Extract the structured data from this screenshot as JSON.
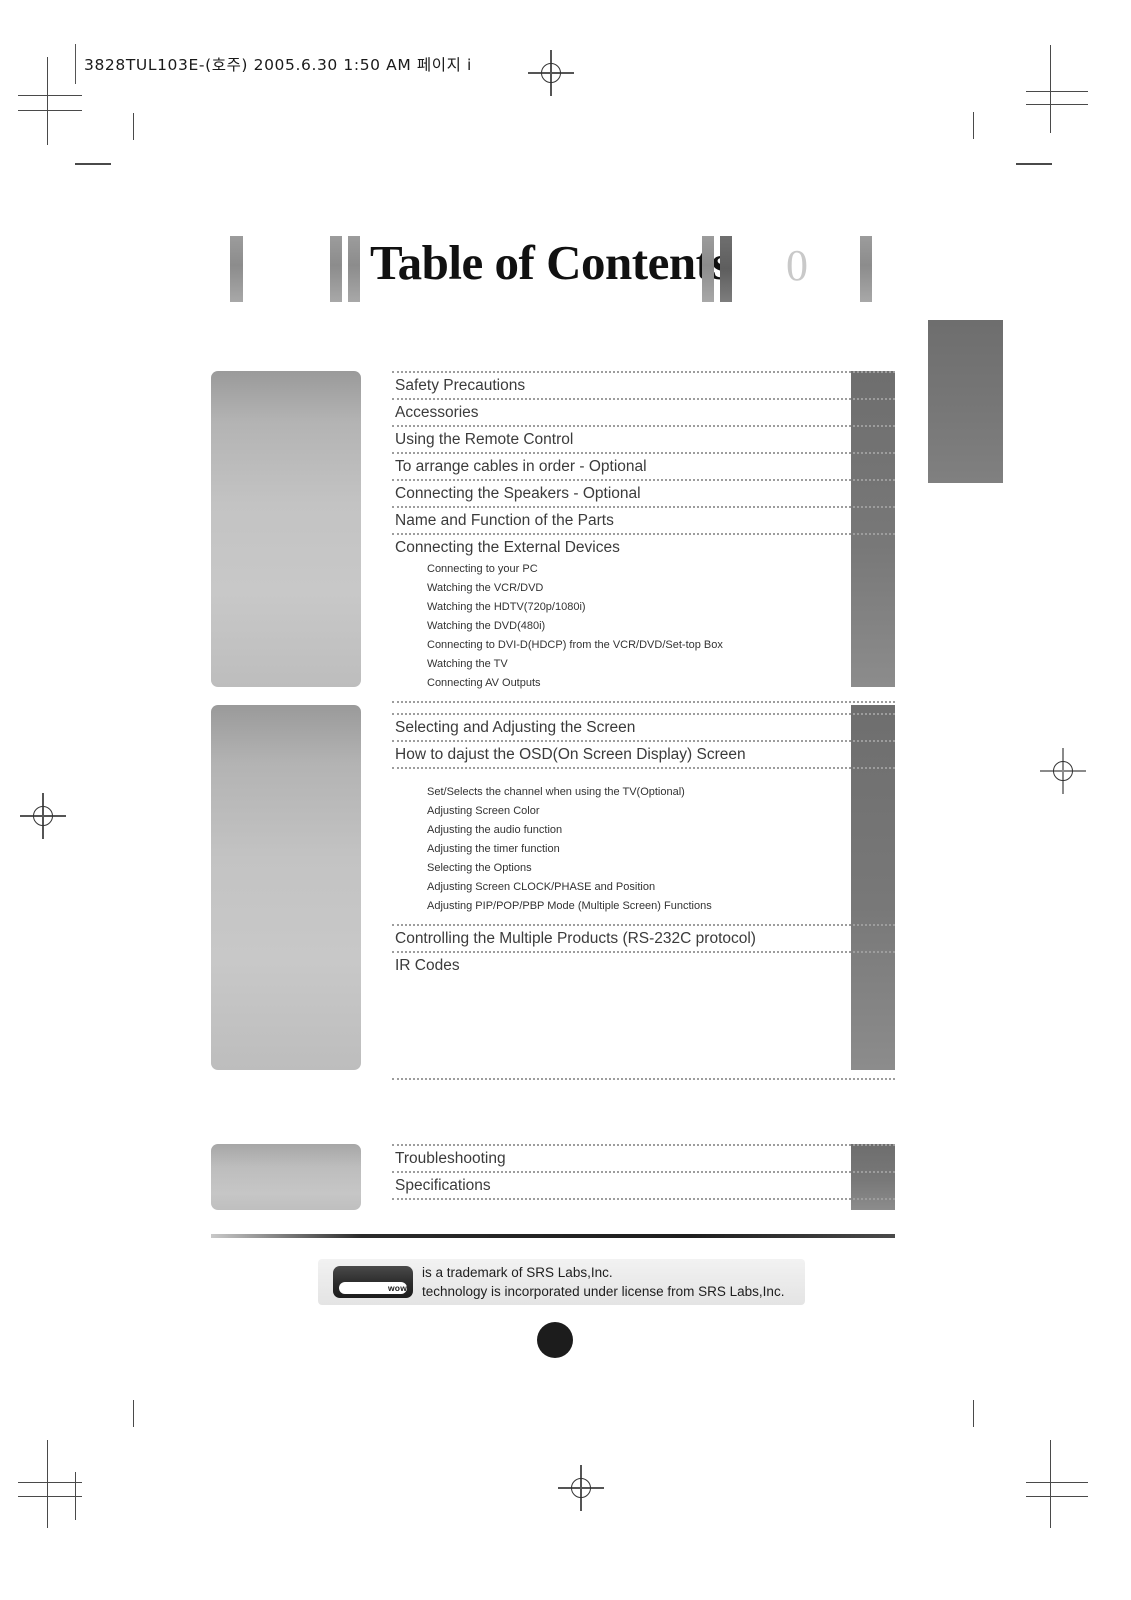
{
  "header": {
    "filename_line": "3828TUL103E-(호주)  2005.6.30 1:50 AM 페이지 i"
  },
  "title": {
    "text": "Table of Contents",
    "number": "0"
  },
  "toc": {
    "section1": {
      "entries": [
        "Safety Precautions",
        "Accessories",
        "Using the Remote Control",
        "To arrange cables in order - Optional",
        "Connecting the Speakers - Optional",
        "Name and Function of the Parts",
        "Connecting the External Devices"
      ],
      "subentries": [
        "Connecting to your PC",
        "Watching the VCR/DVD",
        "Watching the HDTV(720p/1080i)",
        "Watching the DVD(480i)",
        "Connecting to DVI-D(HDCP) from the VCR/DVD/Set-top Box",
        "Watching the TV",
        "Connecting AV Outputs"
      ]
    },
    "section2": {
      "entries": [
        "Selecting and Adjusting the Screen",
        "How to dajust the OSD(On Screen Display) Screen"
      ],
      "subentries": [
        "Set/Selects the channel when using the TV(Optional)",
        "Adjusting Screen Color",
        "Adjusting the audio function",
        "Adjusting the timer function",
        "Selecting the Options",
        "Adjusting Screen CLOCK/PHASE and Position",
        "Adjusting PIP/POP/PBP Mode (Multiple Screen) Functions"
      ],
      "entries_tail": [
        "Controlling the Multiple Products (RS-232C protocol)",
        "IR Codes"
      ]
    },
    "section3": {
      "entries": [
        "Troubleshooting",
        "Specifications"
      ]
    }
  },
  "footer": {
    "logo_text": "wow",
    "line1": "is a trademark of SRS Labs,Inc.",
    "line2": "technology is incorporated under license from SRS Labs,Inc."
  },
  "colors": {
    "page_background": "#ffffff",
    "text": "#3b3b3b",
    "thumb_gray": "#c3c3c3",
    "page_column_gray": "#787878",
    "margin_tab_gray": "#767676",
    "dotted_rule": "#9d9d9d",
    "title_number": "#c9c9c9"
  }
}
